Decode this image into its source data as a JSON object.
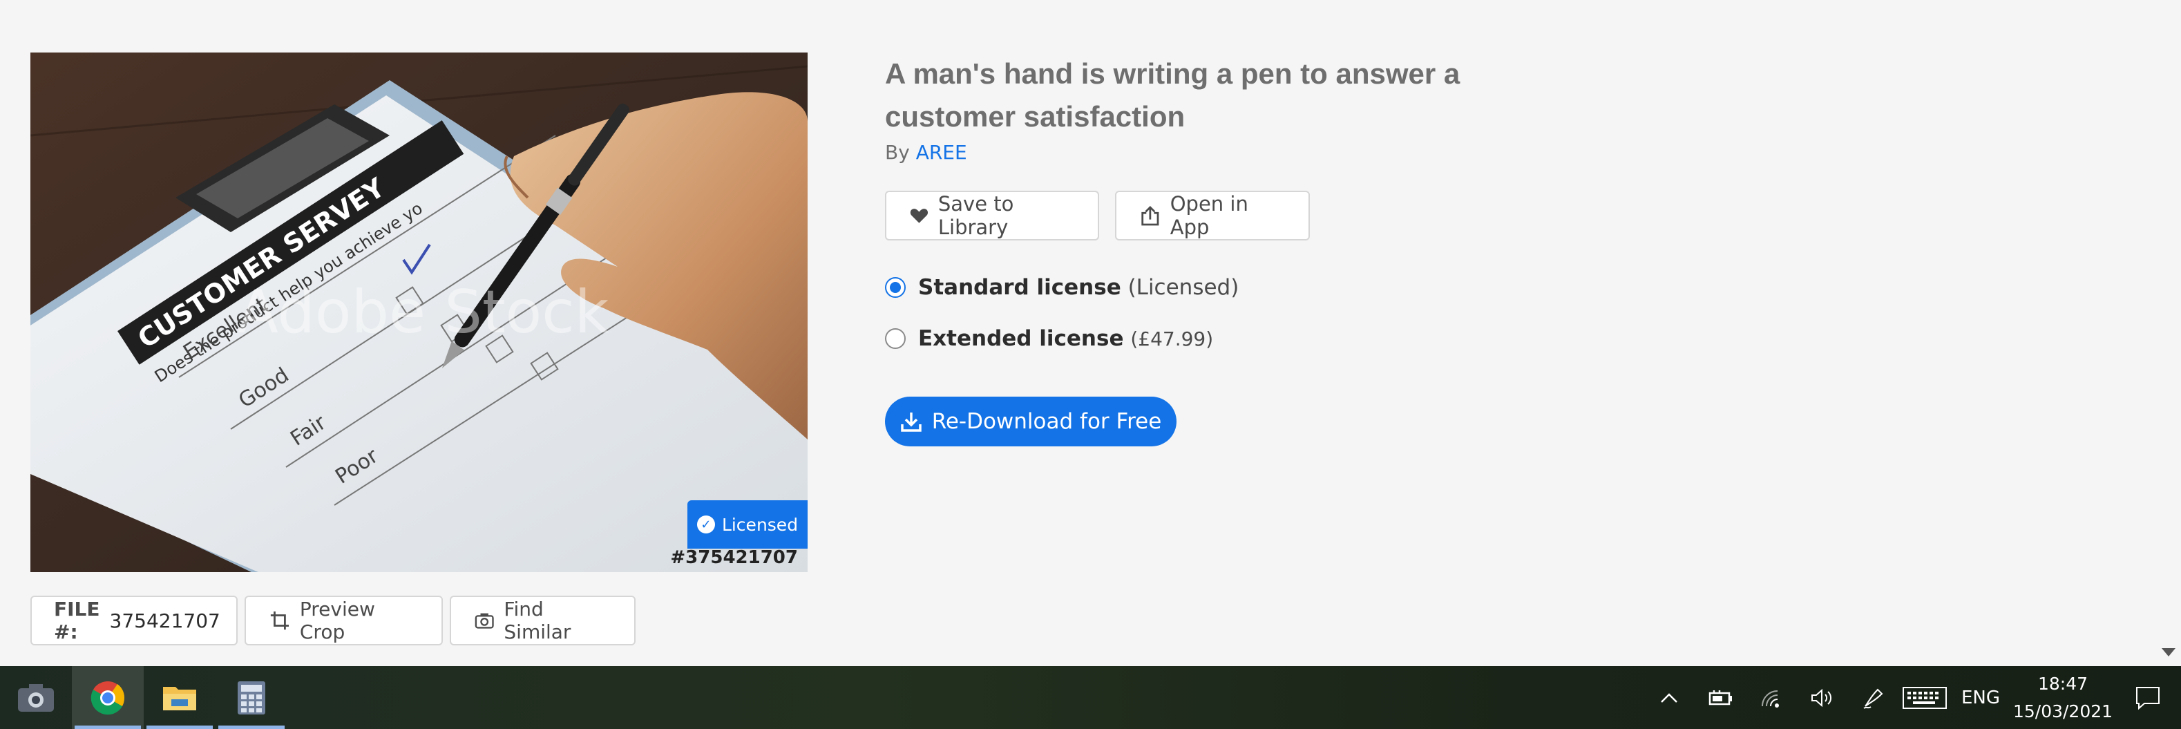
{
  "asset": {
    "title": "A man's hand is writing a pen to answer a customer satisfaction",
    "by_label": "By",
    "author": "AREE",
    "badge": "Licensed",
    "file_id_overlay": "#375421707",
    "watermark": "Adobe Stock",
    "image_text": {
      "heading": "CUSTOMER SERVEY",
      "question": "Does the product help you achieve yo",
      "options": [
        "Excellent",
        "Good",
        "Fair",
        "Poor"
      ]
    }
  },
  "actions": {
    "save": "Save to Library",
    "open": "Open in App",
    "download": "Re-Download for Free"
  },
  "licenses": {
    "standard": {
      "name": "Standard license",
      "note": "(Licensed)",
      "selected": true
    },
    "extended": {
      "name": "Extended license",
      "note": "(£47.99)",
      "selected": false
    }
  },
  "file_bar": {
    "file_label": "FILE #:",
    "file_number": "375421707",
    "preview_crop": "Preview Crop",
    "find_similar": "Find Similar"
  },
  "taskbar": {
    "apps": [
      "camera-icon",
      "chrome-icon",
      "file-explorer-icon",
      "calculator-icon"
    ],
    "active_app": "chrome-icon",
    "language": "ENG",
    "time": "18:47",
    "date": "15/03/2021"
  },
  "colors": {
    "accent": "#1473e6",
    "background": "#f5f5f5",
    "taskbar": "#1d2a22"
  }
}
